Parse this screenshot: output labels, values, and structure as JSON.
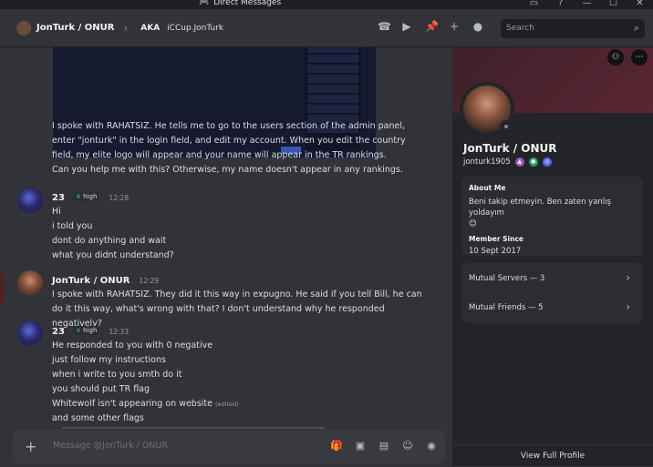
{
  "window": {
    "title": "Direct Messages"
  },
  "header": {
    "name": "JonTurk / ONUR",
    "aka_label": "AKA",
    "aka_value": "iCCup.JonTurk",
    "search_placeholder": "Search"
  },
  "messages": {
    "intro": {
      "text1": "I spoke with RAHATSIZ. He tells me to go to the users section of the admin panel, enter \"jonturk\" in the login field, and edit my account. When you edit the country field, my elite logo will appear and your name will appear in the TR rankings.",
      "text2": "Can you help me with this? Otherwise, my name doesn't appear in any rankings."
    },
    "g1": {
      "author": "23",
      "badge": "high",
      "time": "12:28",
      "lines": [
        "Hi",
        "i told you",
        "dont do anything and wait",
        "what you didnt understand?"
      ]
    },
    "g2": {
      "author": "JonTurk / ONUR",
      "time": "12:29",
      "text": "I spoke with RAHATSIZ. They did it this way in expugno. He said if you tell Bill, he can do it this way, what's wrong with that? I don't understand why he responded negatively?"
    },
    "g3": {
      "author": "23",
      "badge": "high",
      "time": "12:33",
      "lines": [
        "He responded to you with 0 negative",
        "just follow my instructions",
        "when i write to you smth do it",
        "you should put TR flag",
        "Whitewolf isn't appearing on website"
      ],
      "edited": "(edited)",
      "last": "and some other flags"
    }
  },
  "composer": {
    "placeholder": "Message @JonTurk / ONUR"
  },
  "profile": {
    "name": "JonTurk / ONUR",
    "handle": "jonturk1905",
    "about_heading": "About Me",
    "about_text": "Beni takip etmeyin. Ben zaten yanlış yoldayım",
    "member_heading": "Member Since",
    "member_date": "10 Sept 2017",
    "mutual_servers": "Mutual Servers — 3",
    "mutual_friends": "Mutual Friends — 5",
    "view_full": "View Full Profile"
  },
  "colors": {
    "accent": "#5865f2",
    "status_green": "#23a55a",
    "banner": "#4a2330"
  },
  "icons": [
    "inbox-icon",
    "help-icon",
    "minimize-icon",
    "maximize-icon",
    "close-icon",
    "call-icon",
    "video-icon",
    "pin-icon",
    "add-friend-icon",
    "profile-toggle-icon",
    "search-icon",
    "plus-icon",
    "gift-icon",
    "gif-icon",
    "sticker-icon",
    "emoji-icon",
    "game-icon",
    "add-friend-profile-icon",
    "more-icon",
    "chevron-right-icon"
  ]
}
